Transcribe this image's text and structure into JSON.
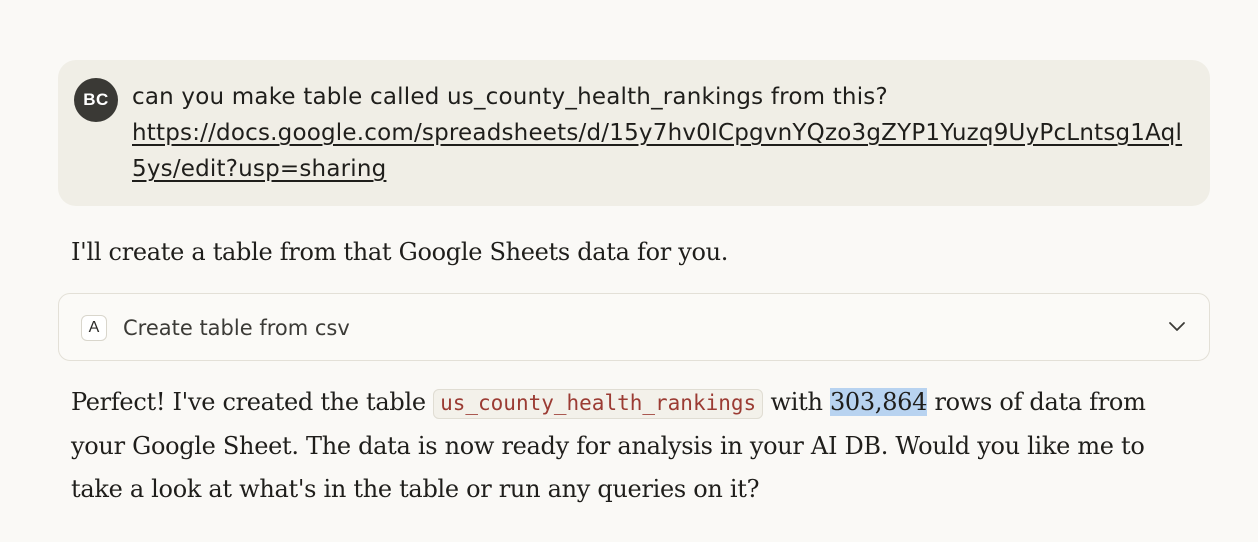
{
  "user_message": {
    "avatar_initials": "BC",
    "text": "can you make table called us_county_health_rankings from this?",
    "link_text": "https://docs.google.com/spreadsheets/d/15y7hv0ICpgvnYQzo3gZYP1Yuzq9UyPcLntsg1Aql5ys/edit?usp=sharing"
  },
  "assistant": {
    "intro": "I'll create a table from that Google Sheets data for you.",
    "tool_card": {
      "badge": "A",
      "label": "Create table from csv",
      "icon": "chevron-down-icon"
    },
    "reply": {
      "part1": "Perfect! I've created the table ",
      "table_name": "us_county_health_rankings",
      "part2": " with ",
      "row_count": "303,864",
      "part3": " rows of data from your Google Sheet. The data is now ready for analysis in your AI DB. Would you like me to take a look at what's in the table or run any queries on it?"
    }
  },
  "colors": {
    "background": "#faf9f6",
    "user_bubble": "#f0eee6",
    "avatar": "#3a3935",
    "code_text": "#9b3b33",
    "selection_highlight": "#b8d3f0"
  }
}
